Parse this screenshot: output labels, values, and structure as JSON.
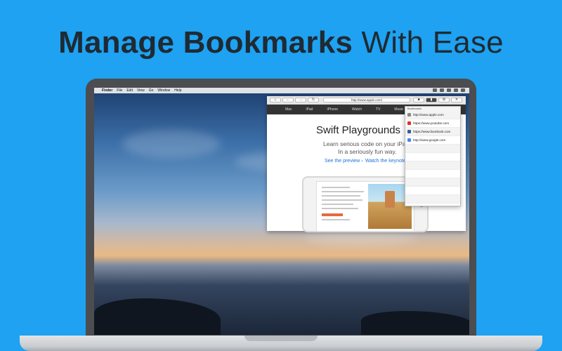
{
  "headline": {
    "bold": "Manage Bookmarks",
    "light": "With Ease"
  },
  "menubar": {
    "apple": "",
    "app": "Finder",
    "items": [
      "File",
      "Edit",
      "View",
      "Go",
      "Window",
      "Help"
    ]
  },
  "browser": {
    "toolbar": {
      "home": "⌂",
      "back": "←",
      "forward": "→",
      "reload": "↻",
      "url": "http://www.apple.com/",
      "bookmarks": "■",
      "bookmark_add": "▮",
      "settings": "⚙",
      "close": "✕"
    },
    "nav": {
      "logo": "",
      "items": [
        "Mac",
        "iPad",
        "iPhone",
        "Watch",
        "TV",
        "Music"
      ]
    },
    "promo": {
      "title": "Swift Playgrounds",
      "sub1": "Learn serious code on your iPad.",
      "sub2": "In a seriously fun way.",
      "link1": "See the preview ›",
      "link2": "Watch the keynote ›"
    }
  },
  "bookmarks": {
    "header": "Bookmarks",
    "items": [
      {
        "url": "http://www.apple.com",
        "icon": "apple-icon",
        "color": "#888888"
      },
      {
        "url": "https://www.youtube.com",
        "icon": "youtube-icon",
        "color": "#e52d27"
      },
      {
        "url": "https://www.facebook.com",
        "icon": "facebook-icon",
        "color": "#3b5998"
      },
      {
        "url": "http://www.google.com",
        "icon": "google-icon",
        "color": "#4285f4"
      }
    ]
  }
}
